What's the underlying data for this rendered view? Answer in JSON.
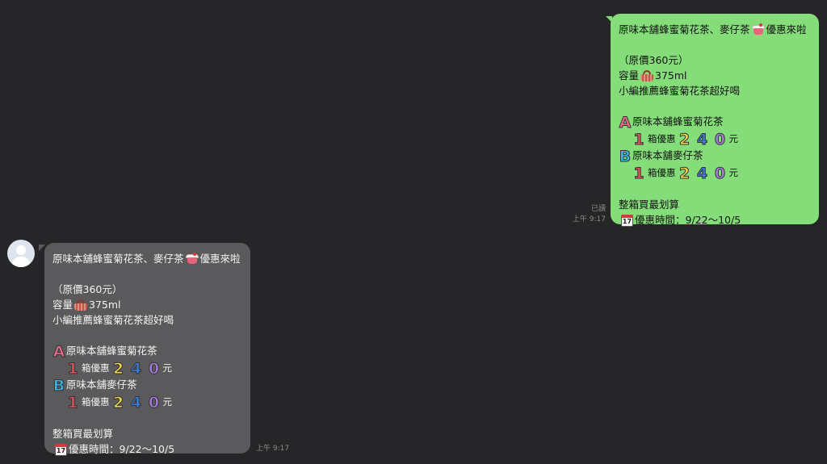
{
  "colors": {
    "background": "#262628",
    "outgoing_bubble": "#85dd7a",
    "incoming_bubble": "#5a5a5c",
    "meta_text": "#8c8c8c"
  },
  "outgoing_message": {
    "line1_text": "原味本舖蜂蜜菊花茶、麥仔茶",
    "line1_suffix": "優惠來啦",
    "line1_icon": "cake-cup-icon",
    "price_line": "（原價360元）",
    "capacity_prefix": "容量",
    "capacity_icon": "basket-icon",
    "capacity_value": "375ml",
    "recommend_line": "小編推薦蜂蜜菊花茶超好喝",
    "option_a_letter": "A",
    "option_a_name": "原味本舖蜂蜜菊花茶",
    "option_a_qty": "1",
    "option_a_unit": "箱優惠",
    "option_a_price_digits": [
      "2",
      "4",
      "0"
    ],
    "option_a_currency": "元",
    "option_b_letter": "B",
    "option_b_name": "原味本舖麥仔茶",
    "option_b_qty": "1",
    "option_b_unit": "箱優惠",
    "option_b_price_digits": [
      "2",
      "4",
      "0"
    ],
    "option_b_currency": "元",
    "bulk_line": "整箱買最划算",
    "calendar_icon": "calendar-icon",
    "calendar_num": "17",
    "period_line": "優惠時間：9/22～10/5",
    "read_status": "已讀",
    "time": "上午 9:17"
  },
  "incoming_message": {
    "line1_text": "原味本舖蜂蜜菊花茶、麥仔茶",
    "line1_suffix": "優惠來啦",
    "line1_icon": "cake-cup-icon",
    "price_line": "（原價360元）",
    "capacity_prefix": "容量",
    "capacity_icon": "basket-icon",
    "capacity_value": "375ml",
    "recommend_line": "小編推薦蜂蜜菊花茶超好喝",
    "option_a_letter": "A",
    "option_a_name": "原味本舖蜂蜜菊花茶",
    "option_a_qty": "1",
    "option_a_unit": "箱優惠",
    "option_a_price_digits": [
      "2",
      "4",
      "0"
    ],
    "option_a_currency": "元",
    "option_b_letter": "B",
    "option_b_name": "原味本舖麥仔茶",
    "option_b_qty": "1",
    "option_b_unit": "箱優惠",
    "option_b_price_digits": [
      "2",
      "4",
      "0"
    ],
    "option_b_currency": "元",
    "bulk_line": "整箱買最划算",
    "calendar_icon": "calendar-icon",
    "calendar_num": "17",
    "period_line": "優惠時間：9/22～10/5",
    "time": "上午 9:17"
  }
}
